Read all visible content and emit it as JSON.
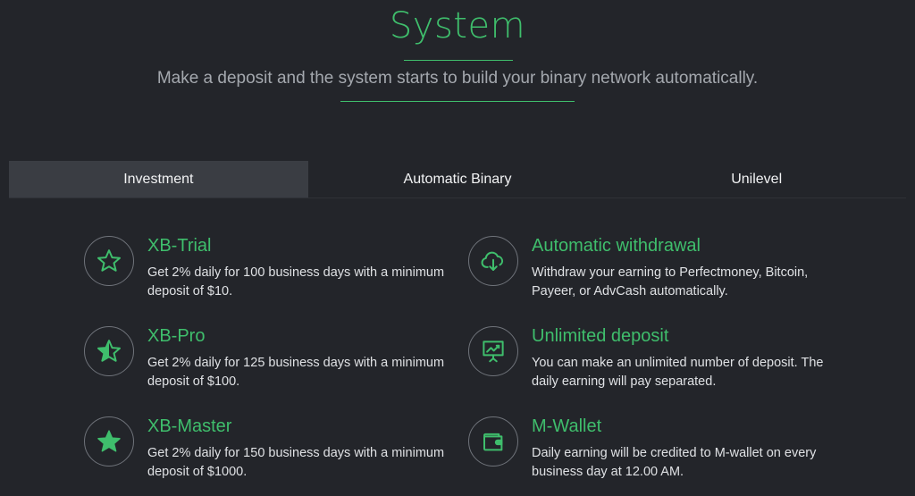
{
  "header": {
    "title": "System",
    "subtitle": "Make a deposit and the system starts to build your binary network automatically."
  },
  "tabs": [
    {
      "label": "Investment",
      "active": true
    },
    {
      "label": "Automatic Binary",
      "active": false
    },
    {
      "label": "Unilevel",
      "active": false
    }
  ],
  "features_left": [
    {
      "icon": "star-outline-icon",
      "title": "XB-Trial",
      "desc": "Get 2% daily for 100 business days with a minimum deposit of $10."
    },
    {
      "icon": "star-half-icon",
      "title": "XB-Pro",
      "desc": "Get 2% daily for 125 business days with a minimum deposit of $100."
    },
    {
      "icon": "star-filled-icon",
      "title": "XB-Master",
      "desc": "Get 2% daily for 150 business days with a minimum deposit of $1000."
    }
  ],
  "features_right": [
    {
      "icon": "cloud-download-icon",
      "title": "Automatic withdrawal",
      "desc": "Withdraw your earning to Perfectmoney, Bitcoin, Payeer, or AdvCash automatically."
    },
    {
      "icon": "presentation-chart-icon",
      "title": "Unlimited deposit",
      "desc": "You can make an unlimited number of deposit. The daily earning will pay separated."
    },
    {
      "icon": "wallet-icon",
      "title": "M-Wallet",
      "desc": "Daily earning will be credited to M-wallet on every business day at 12.00 AM."
    }
  ],
  "colors": {
    "background": "#23252a",
    "accent": "#3fbe6c",
    "active_tab": "#3a3d43"
  }
}
